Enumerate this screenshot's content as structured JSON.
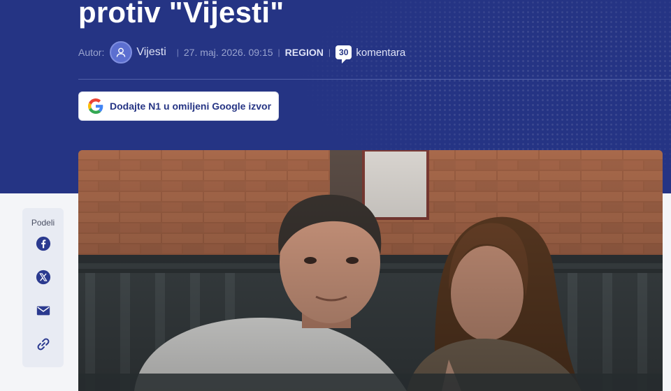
{
  "article": {
    "title": "protiv \"Vijesti\"",
    "author_label": "Autor:",
    "author_name": "Vijesti",
    "date": "27. maj. 2026. 09:15",
    "section": "REGION",
    "comment_count": "30",
    "comments_label": "komentara"
  },
  "google_source_button": {
    "label": "Dodajte N1 u omiljeni Google izvor",
    "icon": "google-g-icon"
  },
  "share": {
    "label": "Podeli",
    "buttons": [
      {
        "icon": "facebook-icon"
      },
      {
        "icon": "x-icon"
      },
      {
        "icon": "mail-icon"
      },
      {
        "icon": "link-icon"
      }
    ]
  },
  "colors": {
    "hero_background": "#253484",
    "accent_text": "#253484",
    "share_icon": "#2b3a8f",
    "page_background": "#f4f5f8"
  }
}
